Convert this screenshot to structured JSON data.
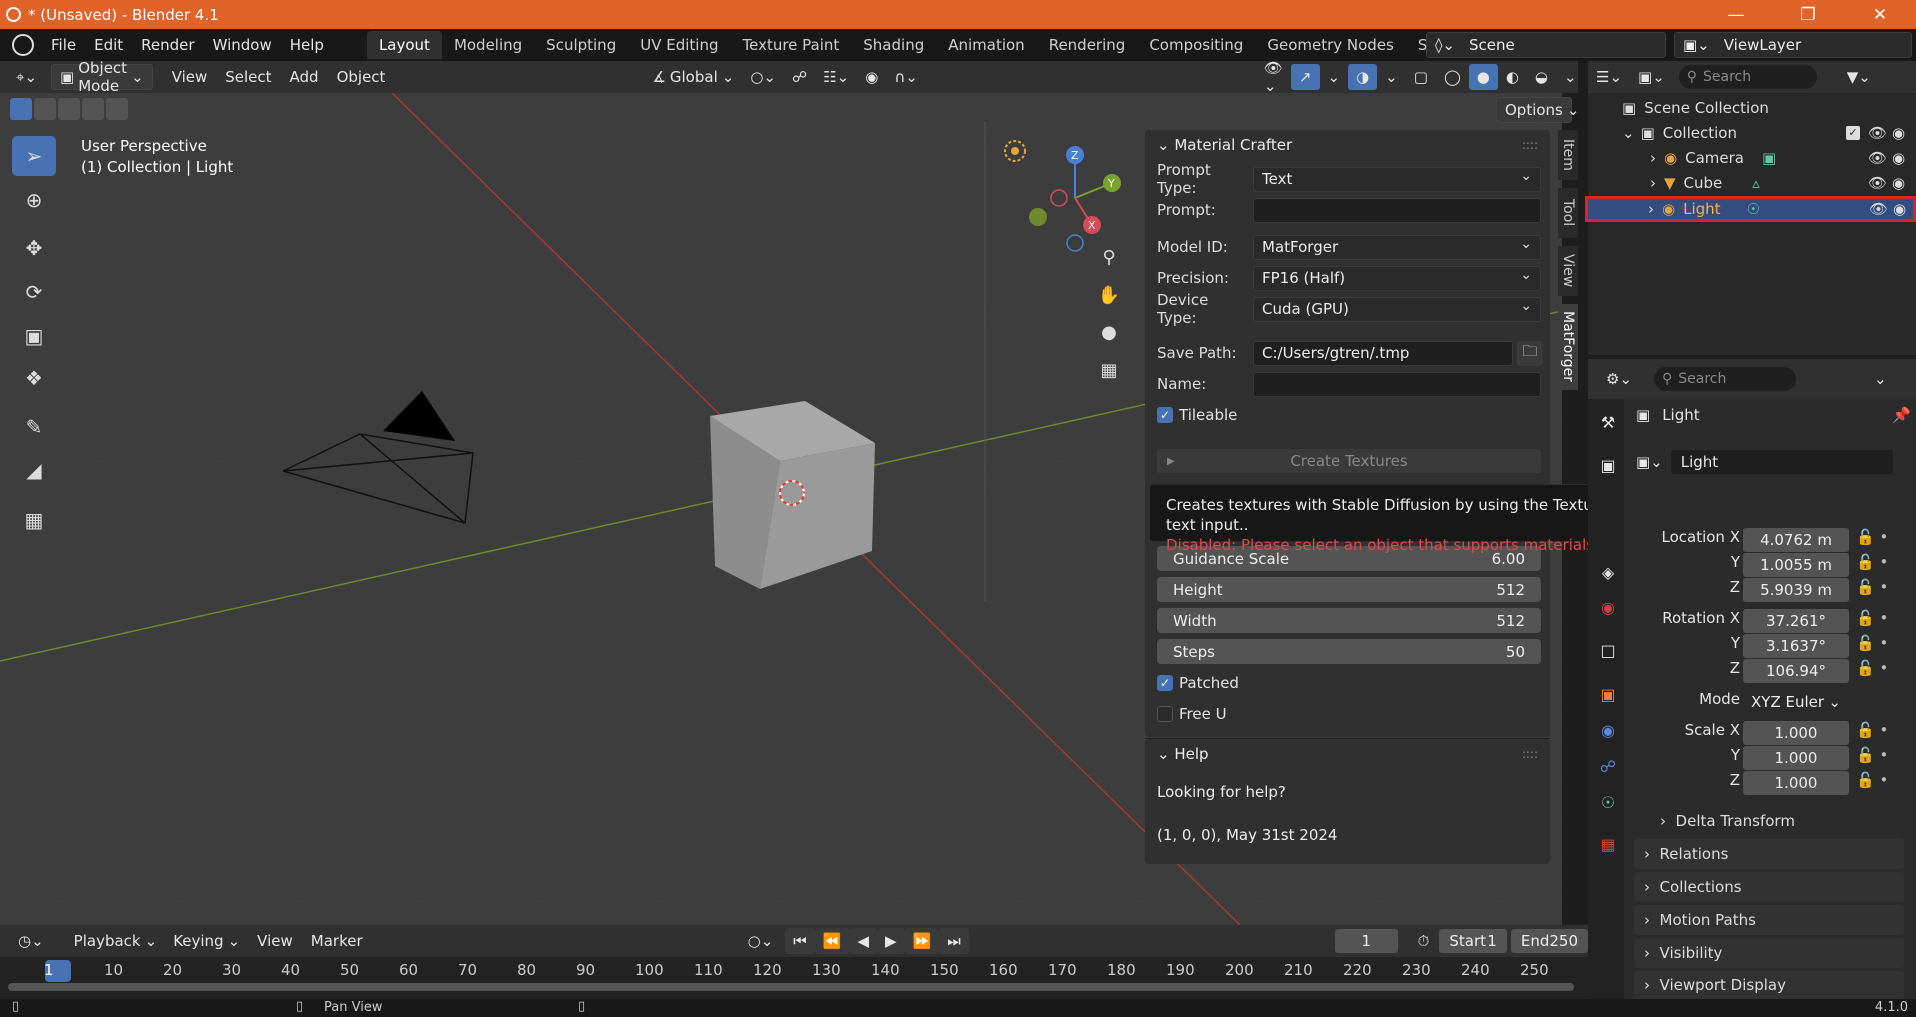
{
  "titlebar": {
    "title": "* (Unsaved) - Blender 4.1",
    "min": "—",
    "max": "❐",
    "close": "✕"
  },
  "menu": [
    "File",
    "Edit",
    "Render",
    "Window",
    "Help"
  ],
  "workspaces": [
    "Layout",
    "Modeling",
    "Sculpting",
    "UV Editing",
    "Texture Paint",
    "Shading",
    "Animation",
    "Rendering",
    "Compositing",
    "Geometry Nodes",
    "Scripting"
  ],
  "scene": "Scene",
  "viewlayer": "ViewLayer",
  "viewport": {
    "mode": "Object Mode",
    "menus": [
      "View",
      "Select",
      "Add",
      "Object"
    ],
    "orientation": "Global",
    "options": "Options",
    "perspective": "User Perspective",
    "collection_info": "(1) Collection | Light",
    "gizmo": {
      "x": "X",
      "y": "Y",
      "z": "Z"
    }
  },
  "npanel": {
    "title": "Material Crafter",
    "prompt_type_label": "Prompt Type:",
    "prompt_type": "Text",
    "prompt_label": "Prompt:",
    "prompt": "",
    "model_label": "Model ID:",
    "model": "MatForger",
    "precision_label": "Precision:",
    "precision": "FP16 (Half)",
    "device_label": "Device Type:",
    "device": "Cuda (GPU)",
    "save_label": "Save Path:",
    "save_path": "C:/Users/gtren/.tmp",
    "name_label": "Name:",
    "name": "",
    "tileable": "Tileable",
    "create": "Create Textures",
    "guidance_label": "Guidance Scale",
    "guidance": "6.00",
    "height_label": "Height",
    "height": "512",
    "width_label": "Width",
    "width": "512",
    "steps_label": "Steps",
    "steps": "50",
    "patched": "Patched",
    "freeu": "Free U",
    "help_title": "Help",
    "help_text": "Looking for help?",
    "version_text": "(1, 0, 0), May 31st 2024",
    "tabs": [
      "Item",
      "Tool",
      "View",
      "MatForger"
    ]
  },
  "tooltip": {
    "line1": "Creates textures with Stable Diffusion by using the Texture Description as text input..",
    "line2": "Disabled: Please select an object that supports materials"
  },
  "outliner": {
    "search": "Search",
    "scene_collection": "Scene Collection",
    "collection": "Collection",
    "items": [
      "Camera",
      "Cube",
      "Light"
    ]
  },
  "properties": {
    "search": "Search",
    "object": "Light",
    "data_name": "Light",
    "loc_label": "Location X",
    "loc": [
      "4.0762 m",
      "1.0055 m",
      "5.9039 m"
    ],
    "rot_label": "Rotation X",
    "rot": [
      "37.261°",
      "3.1637°",
      "106.94°"
    ],
    "mode_label": "Mode",
    "mode": "XYZ Euler",
    "scale_label": "Scale X",
    "scale": [
      "1.000",
      "1.000",
      "1.000"
    ],
    "y": "Y",
    "z": "Z",
    "sections": [
      "Delta Transform",
      "Relations",
      "Collections",
      "Motion Paths",
      "Visibility",
      "Viewport Display"
    ]
  },
  "timeline": {
    "menus": [
      "Playback",
      "Keying",
      "View",
      "Marker"
    ],
    "current": "1",
    "start_label": "Start",
    "start": "1",
    "end_label": "End",
    "end": "250",
    "frames": [
      "1",
      "10",
      "20",
      "30",
      "40",
      "50",
      "60",
      "70",
      "80",
      "90",
      "100",
      "110",
      "120",
      "130",
      "140",
      "150",
      "160",
      "170",
      "180",
      "190",
      "200",
      "210",
      "220",
      "230",
      "240",
      "250"
    ]
  },
  "status": {
    "hint": "Pan View",
    "version": "4.1.0"
  }
}
